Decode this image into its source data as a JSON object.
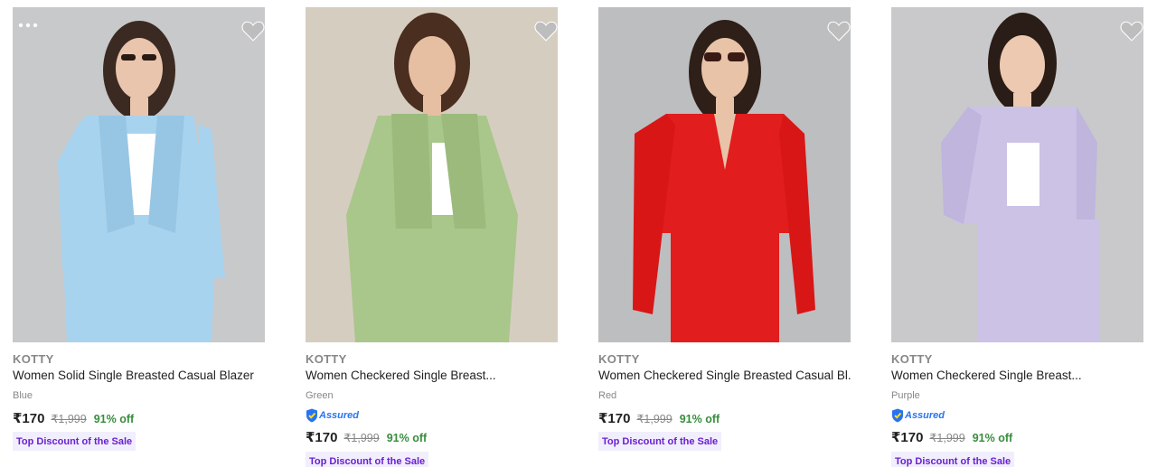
{
  "products": [
    {
      "brand": "KOTTY",
      "title": "Women Solid Single Breasted Casual Blazer",
      "color": "Blue",
      "price": "₹170",
      "mrp": "₹1,999",
      "discount": "91% off",
      "assured": false,
      "tag": "Top Discount of the Sale",
      "bg": "#c8c9cb",
      "outfit": "#a8d3ee"
    },
    {
      "brand": "KOTTY",
      "title": "Women Checkered Single Breast...",
      "color": "Green",
      "price": "₹170",
      "mrp": "₹1,999",
      "discount": "91% off",
      "assured": true,
      "assured_label": "Assured",
      "tag": "Top Discount of the Sale",
      "bg": "#d6cdc1",
      "outfit": "#a9c68b"
    },
    {
      "brand": "KOTTY",
      "title": "Women Checkered Single Breasted Casual Bl...",
      "color": "Red",
      "price": "₹170",
      "mrp": "₹1,999",
      "discount": "91% off",
      "assured": false,
      "tag": "Top Discount of the Sale",
      "bg": "#bdbec0",
      "outfit": "#e11d1d"
    },
    {
      "brand": "KOTTY",
      "title": "Women Checkered Single Breast...",
      "color": "Purple",
      "price": "₹170",
      "mrp": "₹1,999",
      "discount": "91% off",
      "assured": true,
      "assured_label": "Assured",
      "tag": "Top Discount of the Sale",
      "bg": "#c9c9cb",
      "outfit": "#cbc2e6"
    }
  ],
  "colors": {
    "heart": "#bdbdbd",
    "discount_green": "#388e3c",
    "tag_bg": "#f1eefd",
    "tag_text": "#6a1fd0",
    "assured_blue": "#2874f0"
  },
  "icons": [
    "heart-icon",
    "more-dots-icon",
    "assured-badge-icon"
  ]
}
